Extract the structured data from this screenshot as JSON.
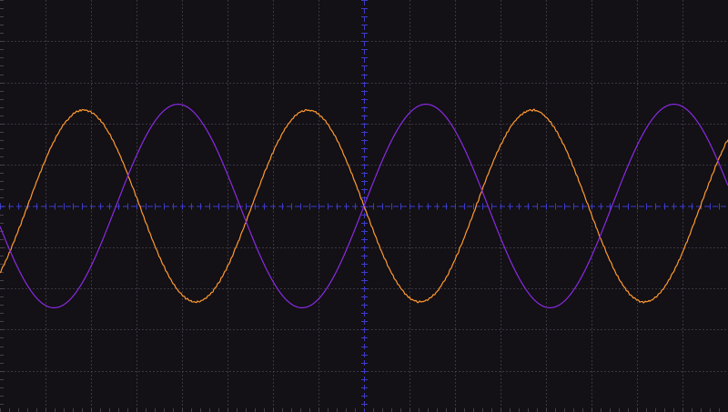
{
  "screen": {
    "background_color": "#131016",
    "grid_color": "#4a4750",
    "center_axis_color": "#3d3dc8"
  },
  "grid": {
    "horizontal_divisions": 16,
    "vertical_divisions": 10,
    "minor_subdivisions": 5
  },
  "traces": [
    {
      "id": "channel-1",
      "color": "#ff9a2e",
      "amplitude_divisions": 2.33,
      "period_divisions": 4.93,
      "phase_degrees": 180,
      "noise": true
    },
    {
      "id": "channel-2",
      "color": "#8a2be2",
      "amplitude_divisions": 2.47,
      "period_divisions": 5.45,
      "phase_degrees": 0,
      "noise": false
    }
  ]
}
